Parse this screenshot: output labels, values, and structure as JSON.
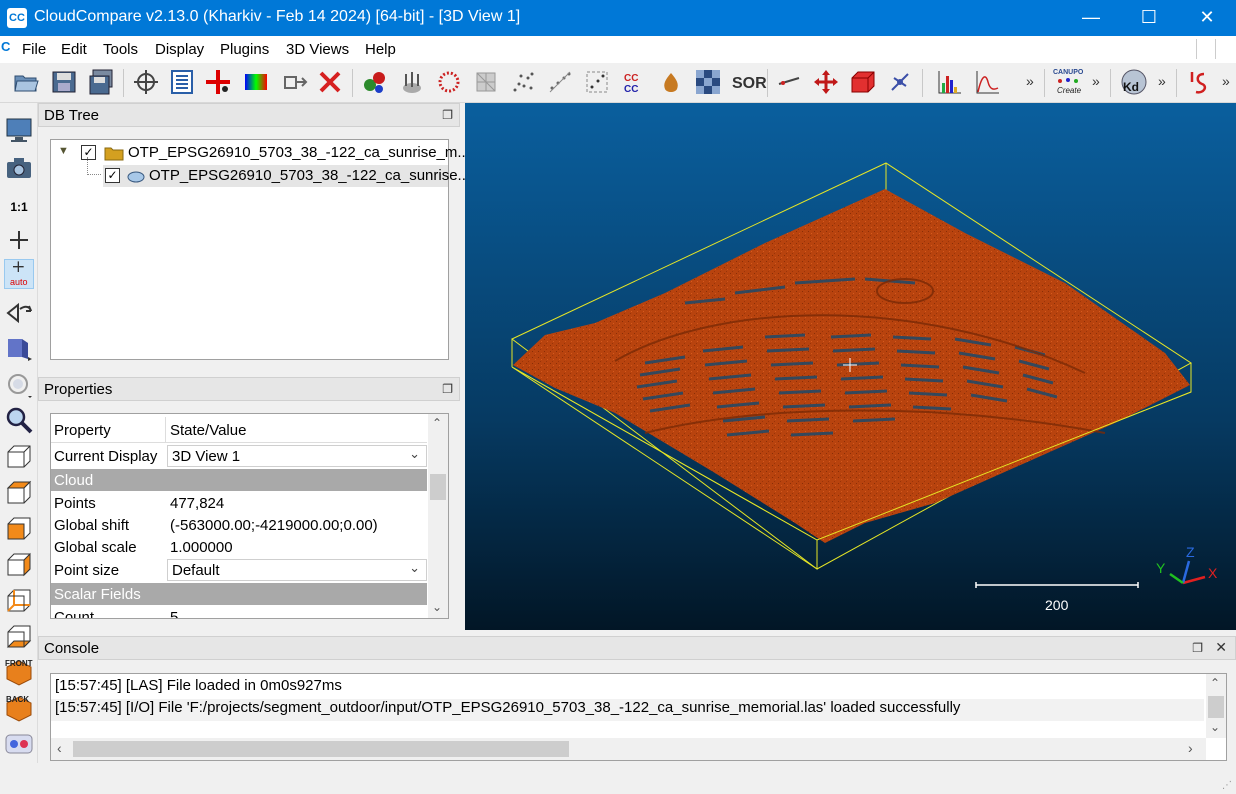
{
  "window": {
    "title": "CloudCompare v2.13.0 (Kharkiv - Feb 14 2024) [64-bit] - [3D View 1]",
    "app_icon": "CC",
    "minimize": "—",
    "maximize": "☐",
    "close": "✕"
  },
  "menubar": {
    "icon": "C",
    "items": [
      "File",
      "Edit",
      "Tools",
      "Display",
      "Plugins",
      "3D Views",
      "Help"
    ]
  },
  "toolbar": {
    "icons": [
      "open-icon",
      "save-icon",
      "save-all-icon",
      "global-shift-icon",
      "list-icon",
      "pick-point-icon",
      "color-scale-icon",
      "clone-icon",
      "delete-icon",
      "merge-icon",
      "normals-icon",
      "sample-icon",
      "mesh-icon",
      "subsample-icon",
      "filter-icon",
      "segment-icon",
      "ccc-icon",
      "sf-icon",
      "checker-icon",
      "sor-icon",
      "cross-section-icon",
      "translate-icon",
      "box-icon",
      "plane-icon",
      "histogram-icon",
      "stat-icon",
      "canupo-icon",
      "kd-tree-icon",
      "s-icon"
    ],
    "sor_label": "SOR",
    "ccc_label": "CCC",
    "canupo_label": "CANUPO",
    "canupo_sub": "Create",
    "kd_label": "Kd",
    "more": "»"
  },
  "left_toolbar": {
    "one_to_one": "1:1",
    "auto_label": "auto",
    "front_label": "FRONT",
    "back_label": "BACK"
  },
  "db_tree": {
    "title": "DB Tree",
    "group_label": "OTP_EPSG26910_5703_38_-122_ca_sunrise_m...",
    "cloud_label": "OTP_EPSG26910_5703_38_-122_ca_sunrise..."
  },
  "properties": {
    "title": "Properties",
    "col_property": "Property",
    "col_value": "State/Value",
    "current_display_key": "Current Display",
    "current_display_value": "3D View 1",
    "section_cloud": "Cloud",
    "points_key": "Points",
    "points_value": "477,824",
    "global_shift_key": "Global shift",
    "global_shift_value": "(-563000.00;-4219000.00;0.00)",
    "global_scale_key": "Global scale",
    "global_scale_value": "1.000000",
    "point_size_key": "Point size",
    "point_size_value": "Default",
    "section_sf": "Scalar Fields",
    "count_key": "Count",
    "count_value": "5"
  },
  "viewport": {
    "scale_value": "200",
    "axis_x": "X",
    "axis_y": "Y",
    "axis_z": "Z",
    "cloud_color": "#b8430e"
  },
  "console": {
    "title": "Console",
    "lines": [
      "[15:57:45] [LAS] File loaded in 0m0s927ms",
      "[15:57:45] [I/O] File 'F:/projects/segment_outdoor/input/OTP_EPSG26910_5703_38_-122_ca_sunrise_memorial.las' loaded successfully"
    ]
  }
}
